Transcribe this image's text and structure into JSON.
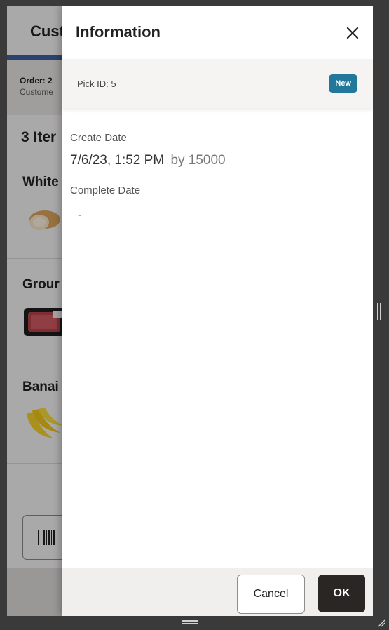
{
  "background": {
    "header_title": "Cust",
    "order_line": "Order: 2",
    "customer_line": "Custome",
    "item_count": "3 Iter",
    "items": [
      {
        "name": "White"
      },
      {
        "name": "Grour"
      },
      {
        "name": "Banai"
      }
    ]
  },
  "drawer": {
    "title": "Information",
    "pick_id": "Pick ID: 5",
    "status_badge": "New",
    "create_date_label": "Create Date",
    "create_date_value": "7/6/23, 1:52 PM",
    "create_date_by": "by 15000",
    "complete_date_label": "Complete Date",
    "complete_date_value": "-",
    "cancel_label": "Cancel",
    "ok_label": "OK"
  },
  "colors": {
    "badge": "#22789a",
    "ok_button": "#2a2623",
    "header_accent": "#3e5fa3"
  },
  "icons": [
    "close-icon",
    "barcode-icon",
    "bread-image",
    "ground-beef-image",
    "bananas-image",
    "resize-grip-icon"
  ]
}
